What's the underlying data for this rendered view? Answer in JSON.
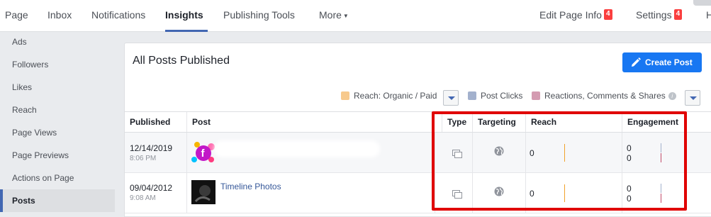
{
  "nav": {
    "items": [
      {
        "label": "Page"
      },
      {
        "label": "Inbox"
      },
      {
        "label": "Notifications"
      },
      {
        "label": "Insights"
      },
      {
        "label": "Publishing Tools"
      },
      {
        "label": "More"
      }
    ],
    "active": "Insights",
    "edit_page_info": {
      "label": "Edit Page Info",
      "badge": "4"
    },
    "settings": {
      "label": "Settings",
      "badge": "4"
    },
    "help_partial": "H"
  },
  "sidebar": {
    "items": [
      {
        "label": "Ads"
      },
      {
        "label": "Followers"
      },
      {
        "label": "Likes"
      },
      {
        "label": "Reach"
      },
      {
        "label": "Page Views"
      },
      {
        "label": "Page Previews"
      },
      {
        "label": "Actions on Page"
      },
      {
        "label": "Posts"
      }
    ],
    "active": "Posts"
  },
  "panel": {
    "title": "All Posts Published",
    "create_post_label": "Create Post"
  },
  "legend": {
    "reach": {
      "label": "Reach: Organic / Paid",
      "color": "#f7c98c"
    },
    "post_clicks": {
      "label": "Post Clicks",
      "color": "#a3b1cd"
    },
    "reactions": {
      "label": "Reactions, Comments & Shares",
      "color": "#d49bb1"
    },
    "info_glyph": "i"
  },
  "table": {
    "headers": {
      "published": "Published",
      "post": "Post",
      "type": "Type",
      "targeting": "Targeting",
      "reach": "Reach",
      "engagement": "Engagement"
    },
    "rows": [
      {
        "date": "12/14/2019",
        "time": "8:06 PM",
        "post_title": "",
        "reach": "0",
        "engagement_clicks": "0",
        "engagement_reactions": "0"
      },
      {
        "date": "09/04/2012",
        "time": "9:08 AM",
        "post_title": "Timeline Photos",
        "reach": "0",
        "engagement_clicks": "0",
        "engagement_reactions": "0"
      }
    ]
  },
  "colors": {
    "accent": "#4267b2",
    "button_blue": "#1877f2",
    "badge_red": "#fa3e3e",
    "highlight_red": "#e00000"
  }
}
